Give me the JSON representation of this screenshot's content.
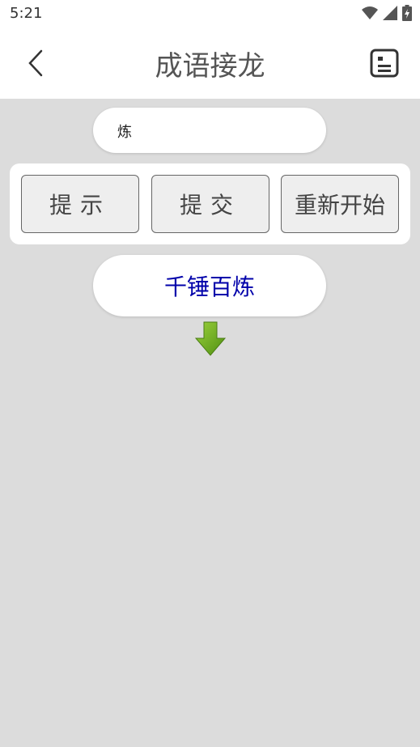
{
  "status_bar": {
    "time": "5:21",
    "icons": [
      "wifi-icon",
      "signal-icon",
      "battery-icon"
    ]
  },
  "app_bar": {
    "title": "成语接龙",
    "back_icon": "chevron-left-icon",
    "menu_icon": "list-card-icon"
  },
  "input": {
    "value": "炼"
  },
  "buttons": {
    "hint": "提示",
    "submit": "提交",
    "restart": "重新开始"
  },
  "chain": {
    "current_idiom": "千锤百炼",
    "idiom_color": "#0000aa",
    "arrow_icon": "down-arrow-icon"
  },
  "colors": {
    "background": "#dcdcdc",
    "button_fill": "#eeeeee",
    "arrow_green": "#6aaa1e"
  }
}
